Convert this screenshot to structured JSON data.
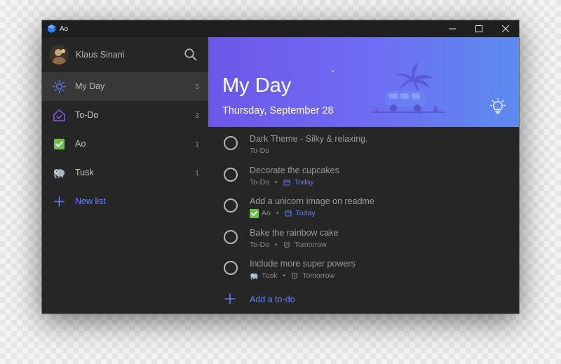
{
  "window": {
    "title": "Ao"
  },
  "sidebar": {
    "user_name": "Klaus Sinani",
    "items": [
      {
        "label": "My Day",
        "count": "5",
        "icon": "sun-icon",
        "active": true
      },
      {
        "label": "To-Do",
        "count": "3",
        "icon": "home-check-icon",
        "active": false
      },
      {
        "label": "Ao",
        "count": "1",
        "icon": "green-check-icon",
        "active": false
      },
      {
        "label": "Tusk",
        "count": "1",
        "icon": "elephant-icon",
        "active": false
      }
    ],
    "new_list_label": "New list"
  },
  "main": {
    "title": "My Day",
    "date": "Thursday, September 28",
    "tasks": [
      {
        "title": "Dark Theme - Silky & relaxing.",
        "list": "To-Do",
        "due": ""
      },
      {
        "title": "Decorate the cupcakes",
        "list": "To-Do",
        "due": "Today"
      },
      {
        "title": "Add a unicorn image on readme",
        "list": "Ao",
        "due": "Today"
      },
      {
        "title": "Bake the rainbow cake",
        "list": "To-Do",
        "due": "Tomorrow"
      },
      {
        "title": "Include more super powers",
        "list": "Tusk",
        "due": "Tomorrow"
      }
    ],
    "add_label": "Add a to-do"
  },
  "colors": {
    "accent": "#5f7fff",
    "window_bg": "#262626",
    "titlebar_bg": "#1f1f1f",
    "sidebar_active": "#383838",
    "banner_start": "#6c57e8",
    "banner_end": "#5c8cf0"
  }
}
